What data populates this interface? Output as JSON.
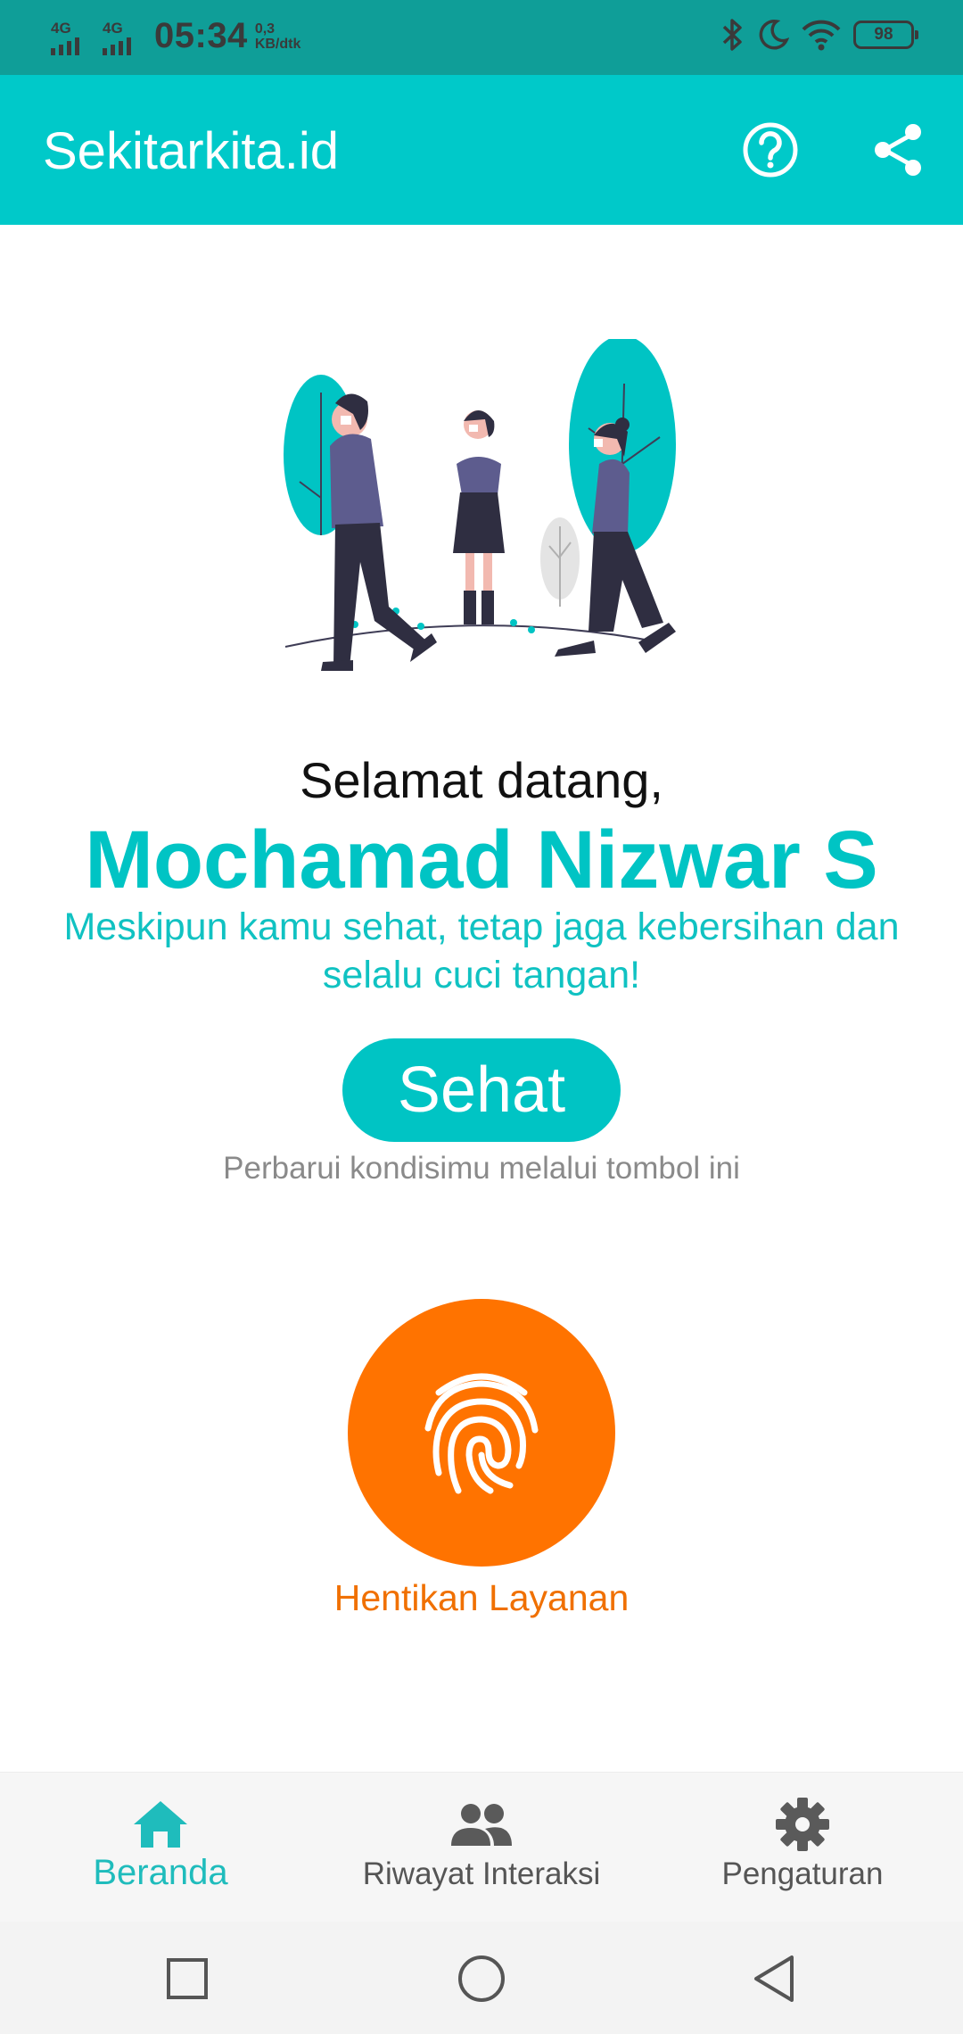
{
  "status_bar": {
    "network_1": "4G",
    "network_2": "4G",
    "time": "05:34",
    "speed_value": "0,3",
    "speed_unit": "KB/dtk",
    "battery": "98",
    "icons": [
      "bluetooth-icon",
      "moon-icon",
      "wifi-icon",
      "battery-icon"
    ]
  },
  "app_bar": {
    "title": "Sekitarkita.id",
    "actions": [
      "help-icon",
      "share-icon"
    ]
  },
  "main": {
    "greeting": "Selamat datang,",
    "user_name": "Mochamad Nizwar S",
    "tip_line1": "Meskipun kamu sehat, tetap jaga kebersihan dan",
    "tip_line2": "selalu cuci tangan!",
    "status_button": "Sehat",
    "status_hint": "Perbarui kondisimu melalui tombol ini",
    "scan_button_label": "Hentikan Layanan"
  },
  "bottom_nav": {
    "items": [
      {
        "label": "Beranda",
        "icon": "home-icon",
        "active": true
      },
      {
        "label": "Riwayat Interaksi",
        "icon": "people-icon",
        "active": false
      },
      {
        "label": "Pengaturan",
        "icon": "gear-icon",
        "active": false
      }
    ]
  },
  "colors": {
    "primary": "#00c9c9",
    "status_bar": "#0f9e98",
    "accent_orange": "#ff7300",
    "nav_active": "#1fbcbc",
    "illustration_purple": "#5d5c8e",
    "illustration_dark": "#2f2e41",
    "skin": "#f2b9b0"
  }
}
